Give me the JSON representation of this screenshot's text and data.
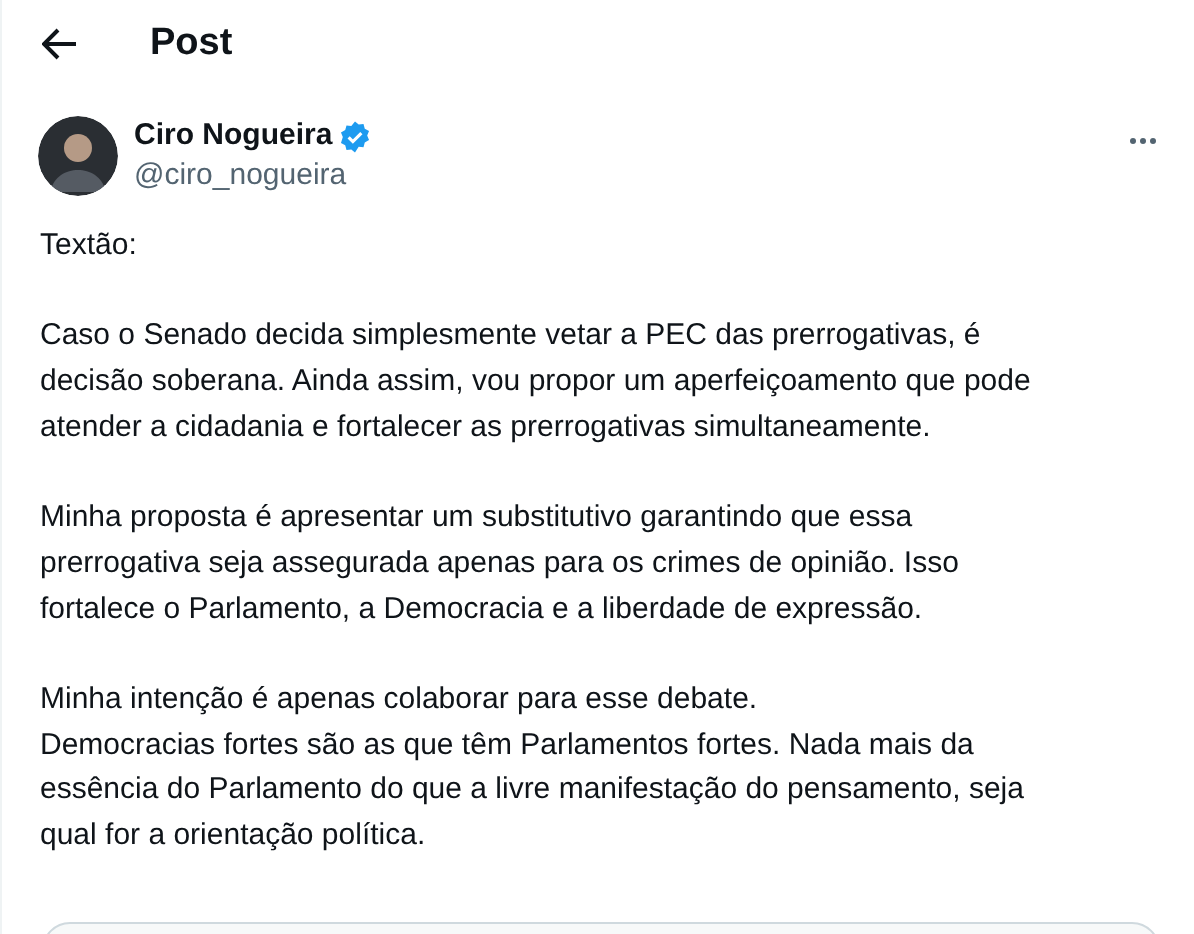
{
  "header": {
    "title": "Post"
  },
  "author": {
    "name": "Ciro Nogueira",
    "verified": true,
    "handle": "@ciro_nogueira"
  },
  "paragraphs": [
    {
      "lines": [
        "Textão:"
      ]
    },
    {
      "lines": [
        "Caso o Senado decida simplesmente vetar a PEC das prerrogativas, é",
        "decisão soberana. Ainda assim, vou propor um aperfeiçoamento que pode",
        "atender a cidadania e fortalecer as prerrogativas simultaneamente."
      ]
    },
    {
      "lines": [
        "Minha proposta é apresentar um substitutivo garantindo que essa",
        "prerrogativa seja assegurada apenas para os crimes de opinião. Isso",
        "fortalece o Parlamento, a Democracia e a liberdade de expressão."
      ]
    },
    {
      "lines": [
        "Minha intenção é apenas colaborar para esse debate.",
        "Democracias fortes são as que têm Parlamentos fortes. Nada mais da",
        "essência do Parlamento do que a livre manifestação do pensamento, seja",
        "qual for a orientação política."
      ]
    }
  ]
}
